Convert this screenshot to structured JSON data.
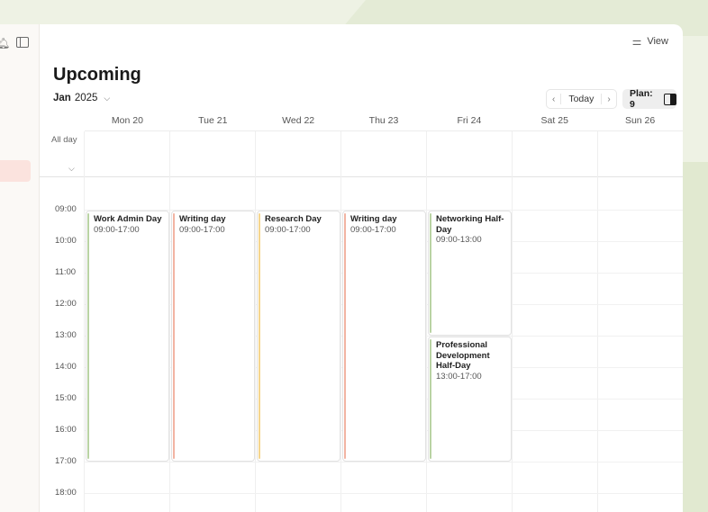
{
  "view_label": "View",
  "page_title": "Upcoming",
  "month_label": "Jan",
  "year_label": "2025",
  "nav": {
    "prev": "‹",
    "today": "Today",
    "next": "›"
  },
  "plan_label": "Plan: 9",
  "all_day_label": "All day",
  "days": [
    "Mon 20",
    "Tue 21",
    "Wed 22",
    "Thu 23",
    "Fri 24",
    "Sat 25",
    "Sun 26"
  ],
  "hours": [
    "09:00",
    "10:00",
    "11:00",
    "12:00",
    "13:00",
    "14:00",
    "15:00",
    "16:00",
    "17:00",
    "18:00"
  ],
  "events": [
    {
      "title": "Work Admin Day",
      "time": "09:00-17:00",
      "day": 0,
      "start": 9,
      "end": 17,
      "color": "#b9d3a3"
    },
    {
      "title": "Writing day",
      "time": "09:00-17:00",
      "day": 1,
      "start": 9,
      "end": 17,
      "color": "#f2b4a3"
    },
    {
      "title": "Research Day",
      "time": "09:00-17:00",
      "day": 2,
      "start": 9,
      "end": 17,
      "color": "#f4d58e"
    },
    {
      "title": "Writing day",
      "time": "09:00-17:00",
      "day": 3,
      "start": 9,
      "end": 17,
      "color": "#f2b4a3"
    },
    {
      "title": "Networking Half-Day",
      "time": "09:00-13:00",
      "day": 4,
      "start": 9,
      "end": 13,
      "color": "#b9d3a3"
    },
    {
      "title": "Professional Development Half-Day",
      "time": "13:00-17:00",
      "day": 4,
      "start": 13,
      "end": 17,
      "color": "#b9d3a3"
    }
  ],
  "colors": {
    "accent_active": "#fbe3de",
    "background": "#eef2e4"
  },
  "icons": {
    "bell": "bell-icon",
    "sidebar_toggle": "sidebar-toggle-icon",
    "view": "sliders-icon",
    "month_chevron": "chevron-down-icon",
    "allday_chevron": "chevron-down-icon"
  }
}
